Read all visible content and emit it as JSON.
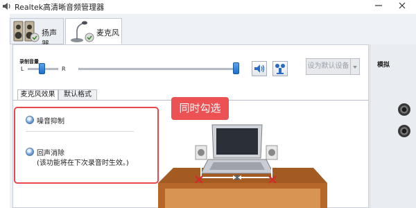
{
  "window": {
    "title": "Realtek高清晰音频管理器"
  },
  "device_tabs": [
    {
      "label": "扬声器",
      "icon": "speaker-icon",
      "active": false
    },
    {
      "label": "麦克风",
      "icon": "microphone-icon",
      "active": true
    }
  ],
  "recording_volume": {
    "label": "录制音量",
    "left_label": "L",
    "right_label": "R",
    "balance_percent": 50,
    "volume_percent": 100
  },
  "default_device_button": {
    "label": "设为默认设备"
  },
  "sub_tabs": [
    {
      "label": "麦克风效果",
      "active": true
    },
    {
      "label": "默认格式",
      "active": false
    }
  ],
  "effects": {
    "noise_suppression": "噪音抑制",
    "echo_cancellation": "回声消除",
    "echo_note": "(该功能将在下次录音时生效。)"
  },
  "callout": {
    "text": "同时勾选"
  },
  "side_panel": {
    "label": "模拟"
  },
  "colors": {
    "highlight": "#e8474c",
    "callout_bg": "#ec5153",
    "slider_thumb": "#1e6fc9"
  }
}
